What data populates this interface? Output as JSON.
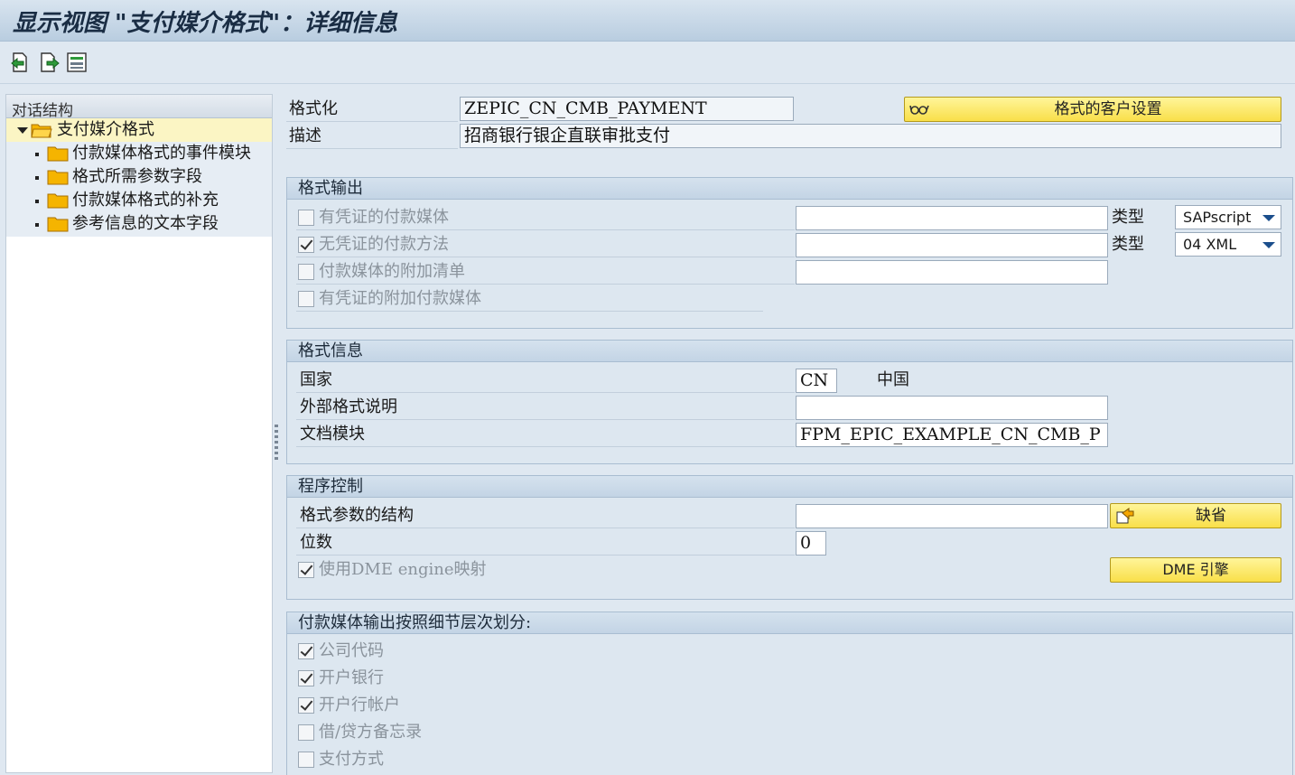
{
  "title": "显示视图 \"支付媒介格式\"：详细信息",
  "toolbar": {
    "icons": [
      "previous-entry-icon",
      "next-entry-icon",
      "select-block-icon"
    ]
  },
  "tree": {
    "header": "对话结构",
    "root": "支付媒介格式",
    "children": [
      "付款媒体格式的事件模块",
      "格式所需参数字段",
      "付款媒体格式的补充",
      "参考信息的文本字段"
    ]
  },
  "header_fields": {
    "format_label": "格式化",
    "format_value": "ZEPIC_CN_CMB_PAYMENT",
    "desc_label": "描述",
    "desc_value": "招商银行银企直联审批支付",
    "customer_settings_button": "格式的客户设置"
  },
  "format_output": {
    "title": "格式输出",
    "rows": [
      {
        "label": "有凭证的付款媒体",
        "checked": false,
        "value": "",
        "type_label": "类型",
        "type_value": "SAPscript"
      },
      {
        "label": "无凭证的付款方法",
        "checked": true,
        "value": "",
        "type_label": "类型",
        "type_value": "04 XML"
      },
      {
        "label": "付款媒体的附加清单",
        "checked": false,
        "value": ""
      },
      {
        "label": "有凭证的附加付款媒体",
        "checked": false
      }
    ]
  },
  "format_info": {
    "title": "格式信息",
    "country_label": "国家",
    "country_code": "CN",
    "country_name": "中国",
    "ext_label": "外部格式说明",
    "ext_value": "",
    "doc_label": "文档模块",
    "doc_value": "FPM_EPIC_EXAMPLE_CN_CMB_P"
  },
  "program_control": {
    "title": "程序控制",
    "struct_label": "格式参数的结构",
    "struct_value": "",
    "default_button": "缺省",
    "digits_label": "位数",
    "digits_value": "0",
    "dme_label": "使用DME engine映射",
    "dme_checked": true,
    "dme_button": "DME 引擎"
  },
  "split": {
    "title": "付款媒体输出按照细节层次划分:",
    "items": [
      {
        "label": "公司代码",
        "checked": true
      },
      {
        "label": "开户银行",
        "checked": true
      },
      {
        "label": "开户行帐户",
        "checked": true
      },
      {
        "label": "借/贷方备忘录",
        "checked": false
      },
      {
        "label": "支付方式",
        "checked": false
      }
    ]
  }
}
